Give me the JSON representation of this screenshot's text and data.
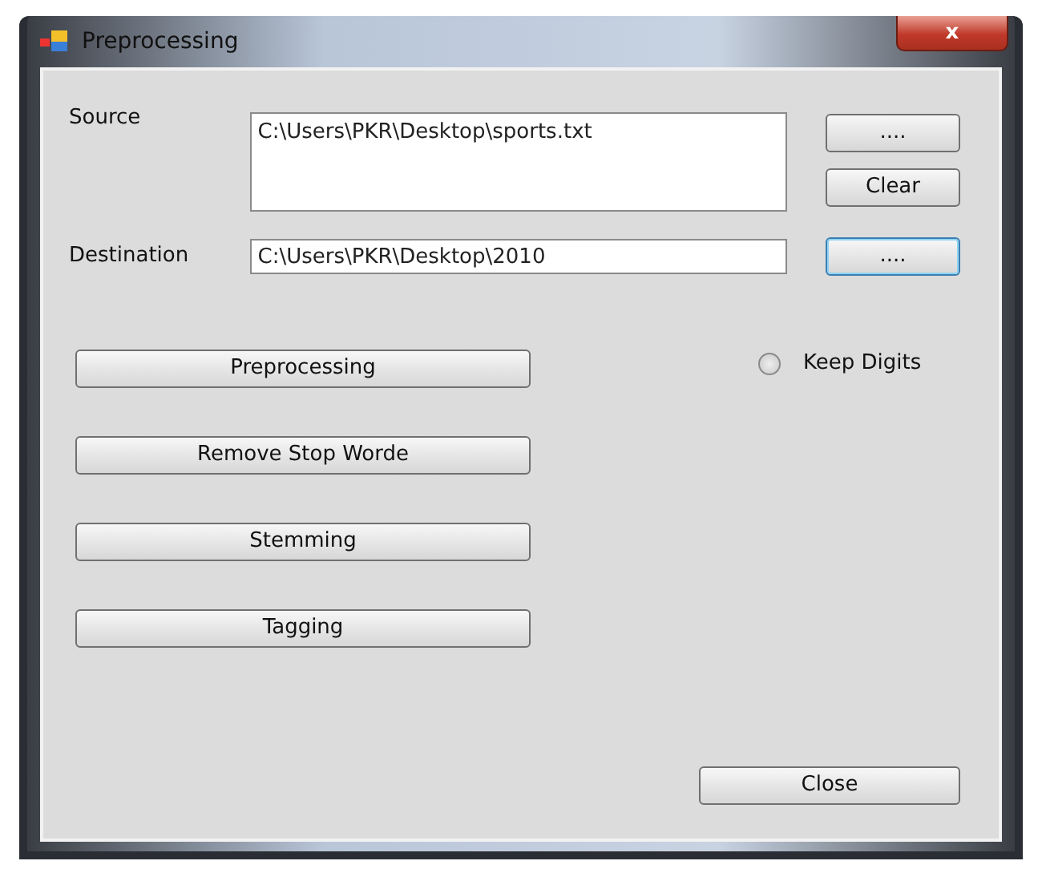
{
  "window": {
    "title": "Preprocessing",
    "close": "x"
  },
  "source": {
    "label": "Source",
    "value": "C:\\Users\\PKR\\Desktop\\sports.txt",
    "buttons": [
      {
        "label": "....",
        "focused": false
      },
      {
        "label": "Clear",
        "focused": false
      }
    ]
  },
  "destination": {
    "label": "Destination",
    "value": "C:\\Users\\PKR\\Desktop\\2010",
    "buttons": [
      {
        "label": "....",
        "focused": true
      }
    ]
  },
  "actions": [
    {
      "label": "Preprocessing"
    },
    {
      "label": "Remove Stop Worde"
    },
    {
      "label": "Stemming"
    },
    {
      "label": "Tagging"
    }
  ],
  "keep_digits": {
    "label": "Keep Digits",
    "checked": false
  },
  "close_button": {
    "label": "Close"
  }
}
